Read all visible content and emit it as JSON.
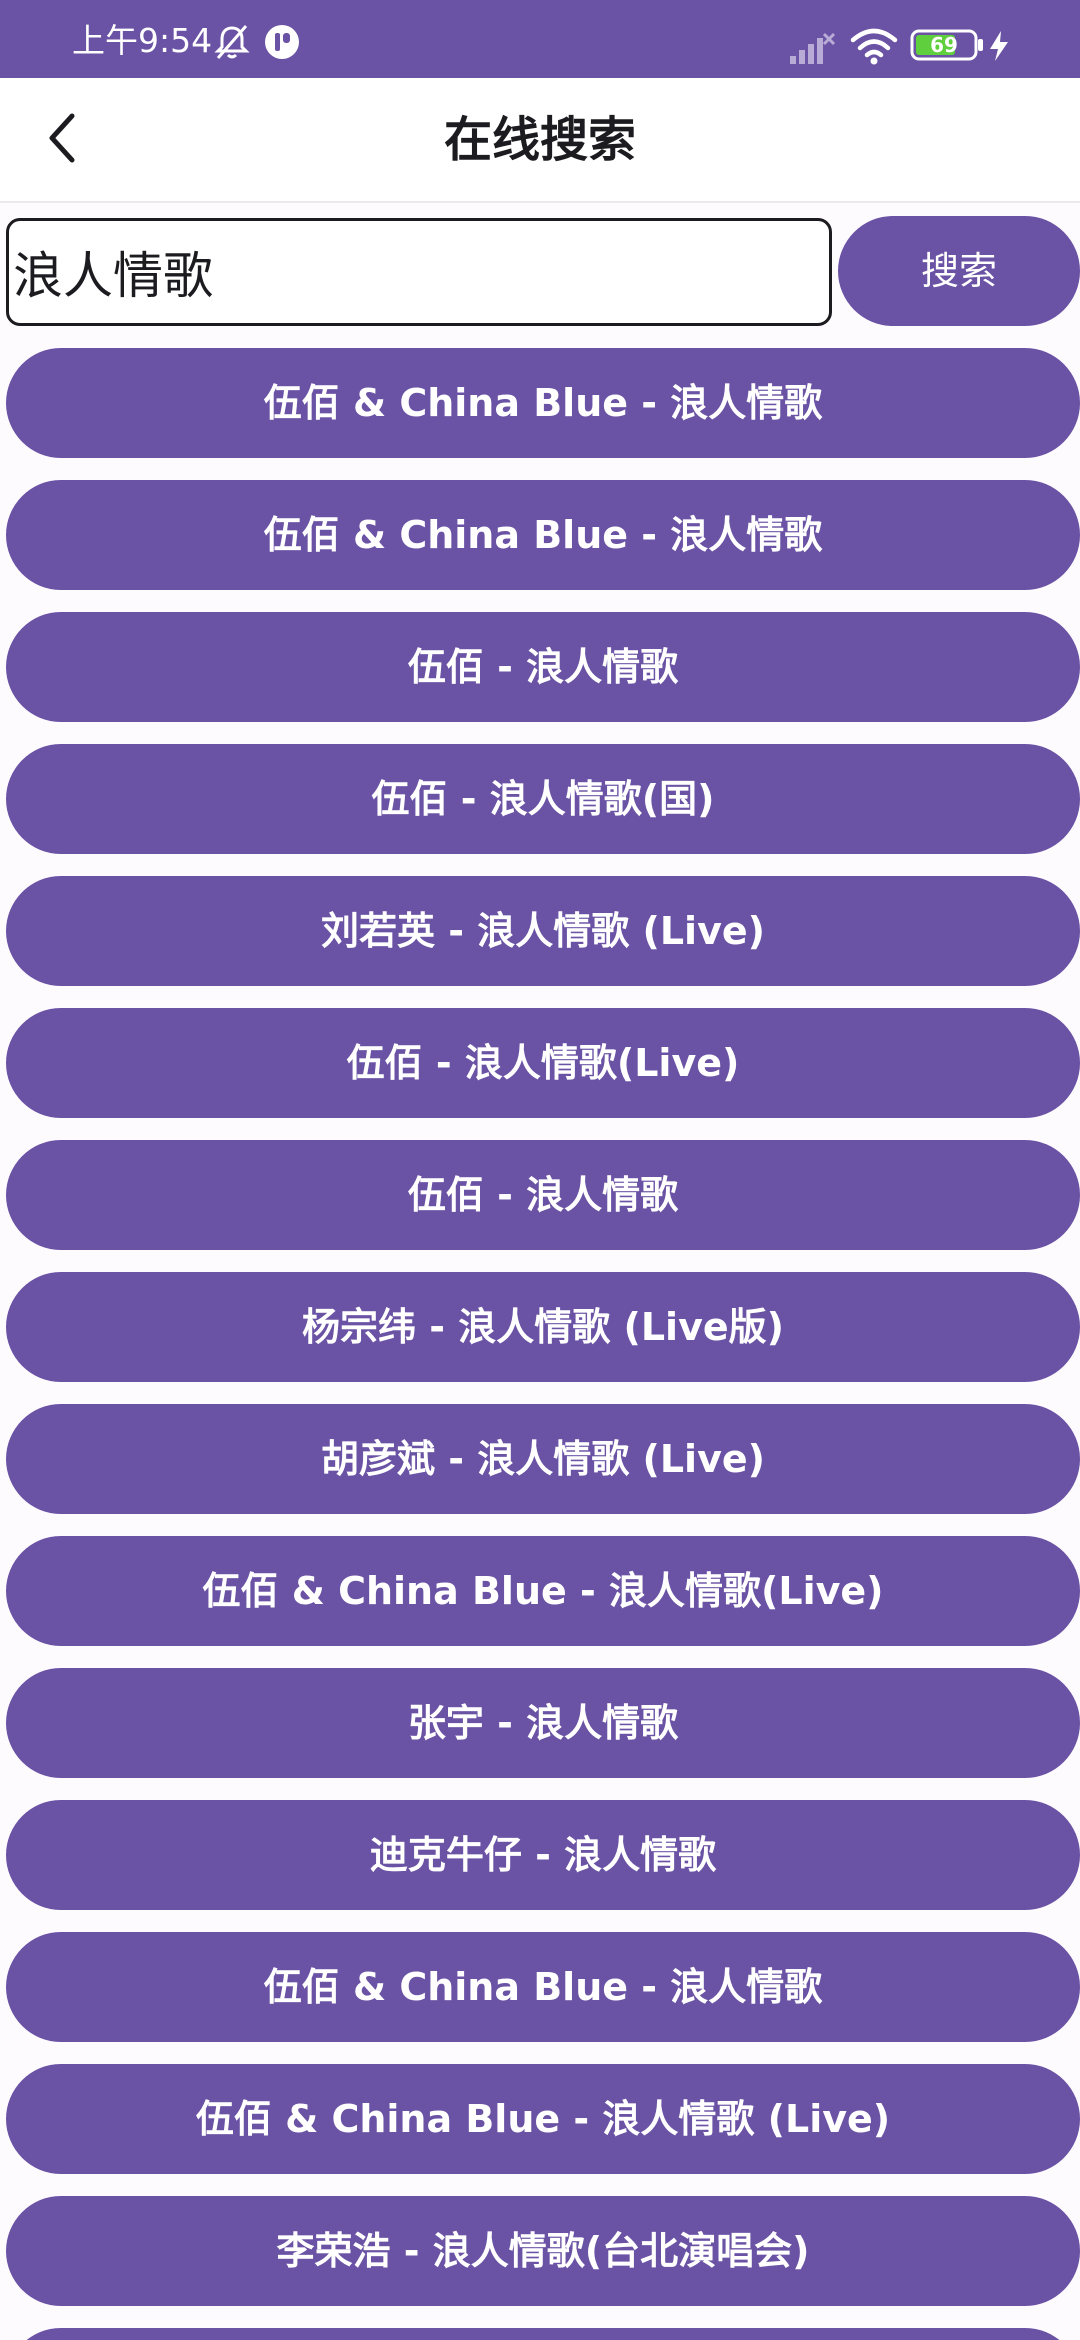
{
  "status_bar": {
    "time": "上午9:54",
    "battery": "69",
    "icons": [
      "notifications-off-icon",
      "app-notification-icon",
      "cellular-signal-icon",
      "wifi-icon",
      "battery-icon",
      "charging-bolt-icon"
    ]
  },
  "colors": {
    "accent": "#6a52a4",
    "background": "#fefbff",
    "text_dark": "#1c1b1f",
    "on_accent": "#ffffff"
  },
  "header": {
    "title": "在线搜索",
    "back_icon": "back-arrow-icon"
  },
  "search": {
    "value": "浪人情歌",
    "button_label": "搜索"
  },
  "results": [
    "伍佰 & China Blue - 浪人情歌",
    "伍佰 & China Blue - 浪人情歌",
    "伍佰 - 浪人情歌",
    "伍佰 - 浪人情歌(国)",
    "刘若英 - 浪人情歌 (Live)",
    "伍佰 - 浪人情歌(Live)",
    "伍佰 - 浪人情歌",
    "杨宗纬 - 浪人情歌 (Live版)",
    "胡彦斌 - 浪人情歌 (Live)",
    "伍佰 & China Blue - 浪人情歌(Live)",
    "张宇 - 浪人情歌",
    "迪克牛仔 - 浪人情歌",
    "伍佰 & China Blue - 浪人情歌",
    "伍佰 & China Blue - 浪人情歌 (Live)",
    "李荣浩 - 浪人情歌(台北演唱会)",
    ""
  ]
}
